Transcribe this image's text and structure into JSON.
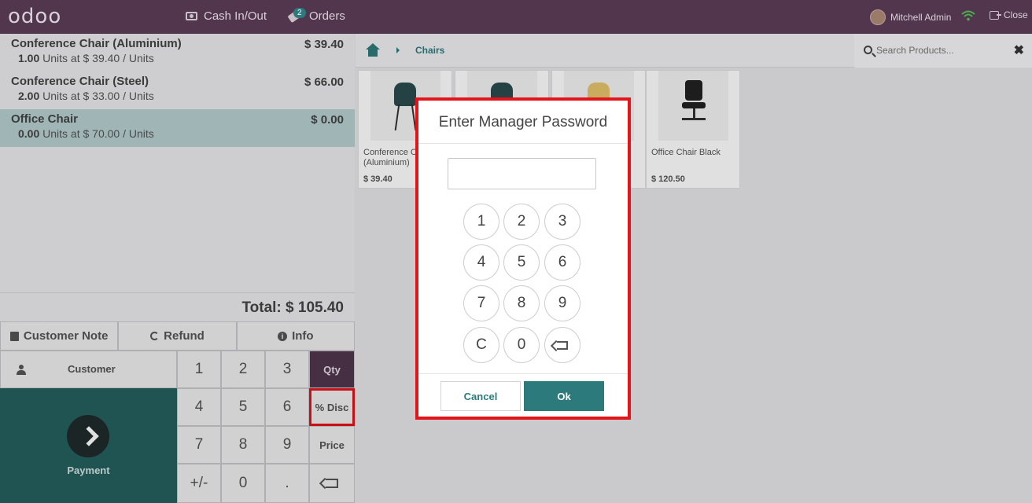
{
  "topbar": {
    "logo": "odoo",
    "cash_label": "Cash In/Out",
    "orders_label": "Orders",
    "orders_badge": "2",
    "user_name": "Mitchell Admin",
    "close_label": "Close"
  },
  "order": {
    "lines": [
      {
        "name": "Conference Chair (Aluminium)",
        "price": "$ 39.40",
        "qty": "1.00",
        "info": " Units at $ 39.40 / Units"
      },
      {
        "name": "Conference Chair (Steel)",
        "price": "$ 66.00",
        "qty": "2.00",
        "info": " Units at $ 33.00 / Units"
      },
      {
        "name": "Office Chair",
        "price": "$ 0.00",
        "qty": "0.00",
        "info": " Units at $ 70.00 / Units"
      }
    ],
    "total": "Total: $ 105.40"
  },
  "controls": {
    "customer_note": "Customer Note",
    "refund": "Refund",
    "info": "Info",
    "customer": "Customer",
    "payment": "Payment"
  },
  "numpad": {
    "keys": [
      "1",
      "2",
      "3",
      "4",
      "5",
      "6",
      "7",
      "8",
      "9",
      "+/-",
      "0",
      "."
    ],
    "qty": "Qty",
    "disc": "% Disc",
    "price": "Price"
  },
  "products": {
    "breadcrumb": "Chairs",
    "search_placeholder": "Search Products...",
    "clear": "✖",
    "items": [
      {
        "name": "Conference Chair (Aluminium)",
        "price": "$ 39.40"
      },
      {
        "name": "",
        "price": ""
      },
      {
        "name": "",
        "price": ""
      },
      {
        "name": "Office Chair Black",
        "price": "$ 120.50"
      }
    ]
  },
  "modal": {
    "title": "Enter Manager Password",
    "keys": [
      "1",
      "2",
      "3",
      "4",
      "5",
      "6",
      "7",
      "8",
      "9",
      "C",
      "0"
    ],
    "cancel": "Cancel",
    "ok": "Ok"
  },
  "colors": {
    "topbar": "#51364d",
    "accent": "#2d7a7d",
    "payment": "#24605f",
    "highlight": "#e4141b"
  }
}
